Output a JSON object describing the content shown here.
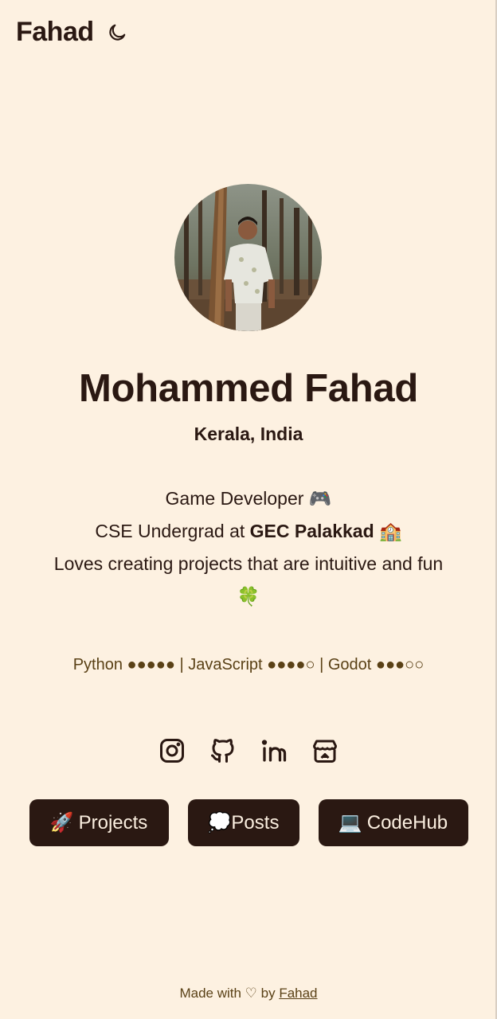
{
  "header": {
    "brand": "Fahad",
    "theme_toggle_icon": "moon-icon"
  },
  "profile": {
    "photo_alt": "Mohammed Fahad",
    "name": "Mohammed Fahad",
    "location": "Kerala, India"
  },
  "bio": {
    "line1_text": "Game Developer",
    "line1_emoji": "🎮",
    "line2_prefix": "CSE Undergrad at ",
    "line2_bold": "GEC Palakkad",
    "line2_emoji": "🏫",
    "line3_text": "Loves creating projects that are intuitive and fun",
    "line3_emoji": "🍀"
  },
  "skills": {
    "text": "Python ●●●●● | JavaScript ●●●●○ | Godot ●●●○○"
  },
  "socials": [
    {
      "name": "Instagram",
      "icon": "instagram-icon"
    },
    {
      "name": "GitHub",
      "icon": "github-icon"
    },
    {
      "name": "LinkedIn",
      "icon": "linkedin-icon"
    },
    {
      "name": "itch.io",
      "icon": "itchio-icon"
    }
  ],
  "buttons": {
    "projects": {
      "emoji": "🚀",
      "label": "Projects"
    },
    "posts": {
      "emoji": "💭",
      "label": "Posts"
    },
    "codehub": {
      "emoji": "💻",
      "label": "CodeHub"
    }
  },
  "footer": {
    "prefix": "Made with ♡ by ",
    "link": "Fahad"
  },
  "colors": {
    "background": "#fdf1e1",
    "primary": "#2a1812",
    "muted": "#5a4116",
    "button_text": "#fbefe0"
  }
}
